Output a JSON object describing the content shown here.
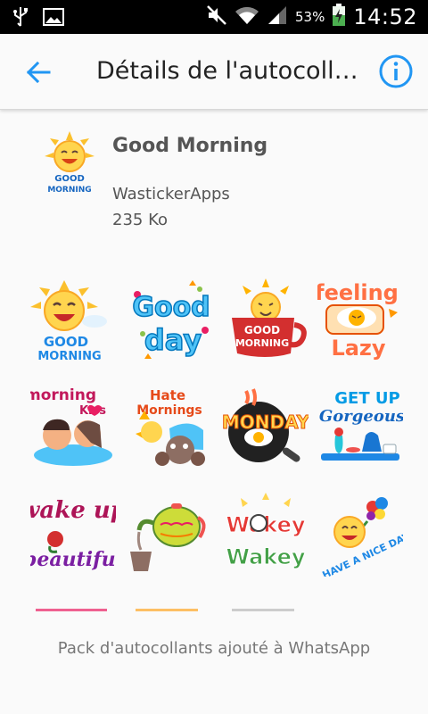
{
  "status_bar": {
    "battery_percent": "53%",
    "time": "14:52",
    "icons": [
      "usb-icon",
      "image-icon",
      "mute-icon",
      "wifi-icon",
      "signal-icon",
      "battery-charging-icon"
    ]
  },
  "app_bar": {
    "title": "Détails de l'autocoll…",
    "back_icon": "arrow-back-icon",
    "info_icon": "info-icon",
    "accent_color": "#2196f3"
  },
  "pack": {
    "name": "Good Morning",
    "publisher": "WastickerApps",
    "size": "235 Ko",
    "icon_text": [
      "GOOD",
      "MORNING"
    ]
  },
  "stickers": [
    {
      "id": "good-morning-sun",
      "lines": [
        "GOOD",
        "MORNING"
      ]
    },
    {
      "id": "good-day",
      "lines": [
        "Good",
        "day"
      ]
    },
    {
      "id": "good-morning-mug",
      "lines": [
        "GOOD",
        "MORNING"
      ]
    },
    {
      "id": "feeling-lazy",
      "lines": [
        "feeling",
        "Lazy"
      ]
    },
    {
      "id": "morning-kiss",
      "lines": [
        "morning",
        "Kiss"
      ]
    },
    {
      "id": "hate-mornings",
      "lines": [
        "Hate",
        "Mornings"
      ]
    },
    {
      "id": "monday",
      "lines": [
        "MONDAY"
      ]
    },
    {
      "id": "get-up-gorgeous",
      "lines": [
        "GET UP",
        "Gorgeous"
      ]
    },
    {
      "id": "wake-up-beautiful",
      "lines": [
        "wake up",
        "beautiful"
      ]
    },
    {
      "id": "teapot",
      "lines": []
    },
    {
      "id": "wakey-wakey",
      "lines": [
        "Wakey",
        "Wakey"
      ]
    },
    {
      "id": "have-a-nice-day",
      "lines": [
        "HAVE A NICE DAY"
      ]
    }
  ],
  "footer": {
    "text": "Pack d'autocollants ajouté à WhatsApp"
  }
}
